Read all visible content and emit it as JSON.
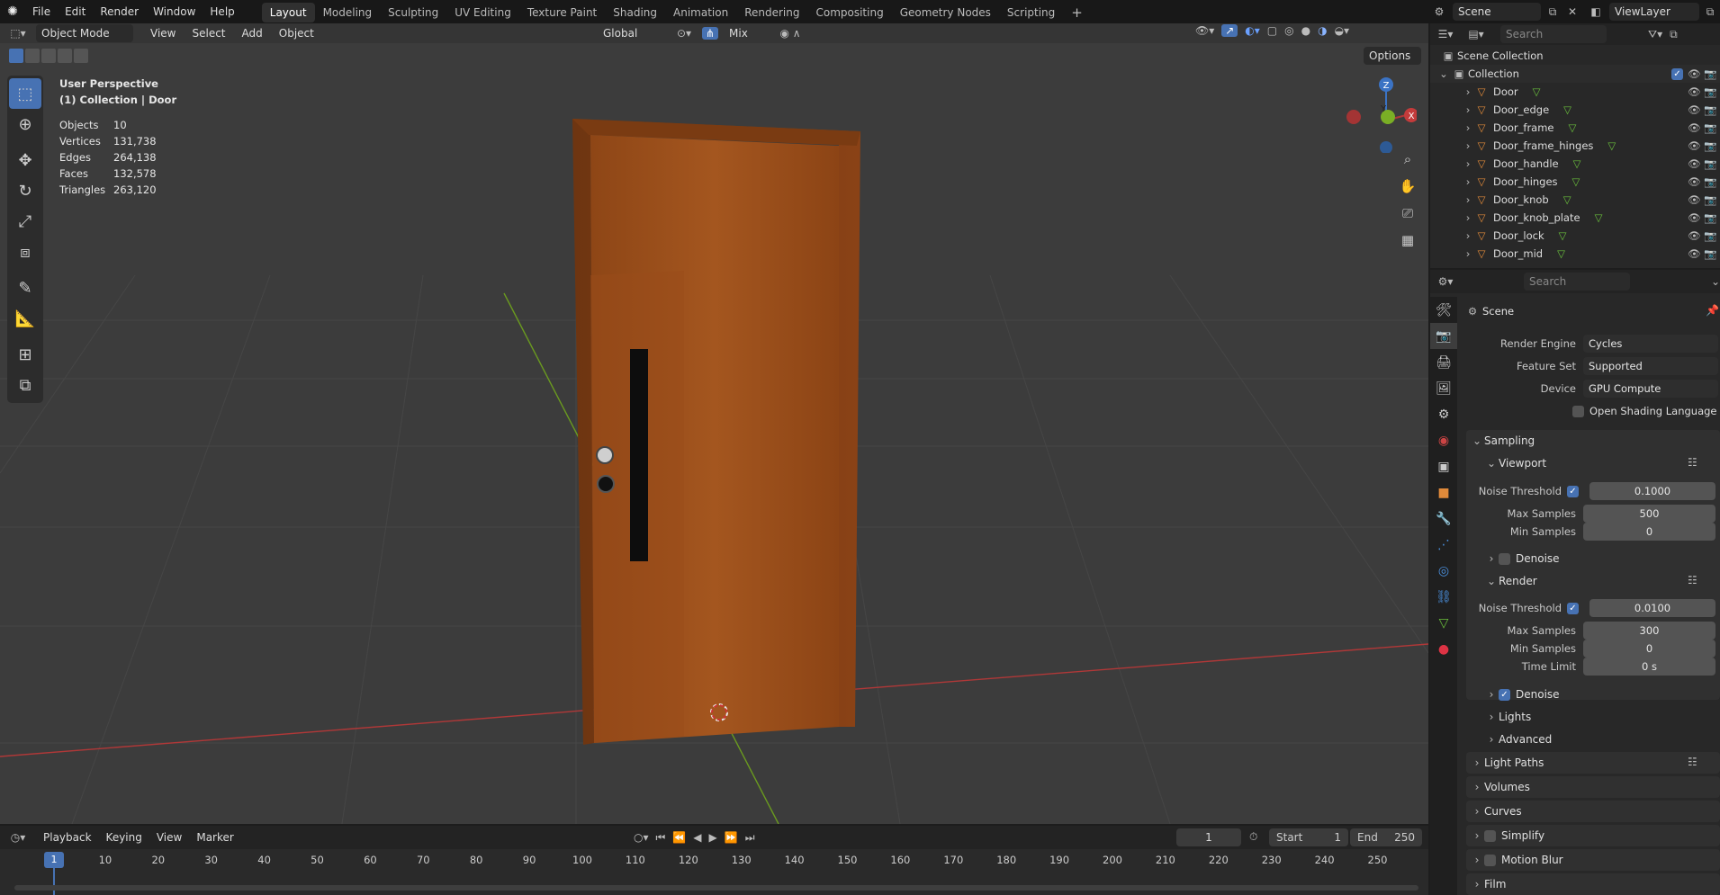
{
  "topbar": {
    "menus": [
      "File",
      "Edit",
      "Render",
      "Window",
      "Help"
    ],
    "workspaces": [
      "Layout",
      "Modeling",
      "Sculpting",
      "UV Editing",
      "Texture Paint",
      "Shading",
      "Animation",
      "Rendering",
      "Compositing",
      "Geometry Nodes",
      "Scripting"
    ],
    "active_workspace": "Layout",
    "add_workspace": "+",
    "scene": "Scene",
    "view_layer": "ViewLayer"
  },
  "viewport": {
    "mode": "Object Mode",
    "menus": [
      "View",
      "Select",
      "Add",
      "Object"
    ],
    "transform_orientation": "Global",
    "snap_mode": "Mix",
    "options_label": "Options",
    "perspective": "User Perspective",
    "collection_path": "(1) Collection | Door",
    "stats": [
      {
        "label": "Objects",
        "value": "10"
      },
      {
        "label": "Vertices",
        "value": "131,738"
      },
      {
        "label": "Edges",
        "value": "264,138"
      },
      {
        "label": "Faces",
        "value": "132,578"
      },
      {
        "label": "Triangles",
        "value": "263,120"
      }
    ],
    "gizmo_labels": {
      "z": "Z",
      "y": "Y",
      "x": "X"
    }
  },
  "outliner": {
    "search_placeholder": "Search",
    "scene_collection": "Scene Collection",
    "collection": "Collection",
    "objects": [
      "Door",
      "Door_edge",
      "Door_frame",
      "Door_frame_hinges",
      "Door_handle",
      "Door_hinges",
      "Door_knob",
      "Door_knob_plate",
      "Door_lock",
      "Door_mid"
    ]
  },
  "properties": {
    "search_placeholder": "Search",
    "context_title": "Scene",
    "render_engine_label": "Render Engine",
    "render_engine": "Cycles",
    "feature_set_label": "Feature Set",
    "feature_set": "Supported",
    "device_label": "Device",
    "device": "GPU Compute",
    "osl_label": "Open Shading Language",
    "sampling_label": "Sampling",
    "viewport_label": "Viewport",
    "noise_threshold_label": "Noise Threshold",
    "viewport_noise_threshold": "0.1000",
    "max_samples_label": "Max Samples",
    "viewport_max_samples": "500",
    "min_samples_label": "Min Samples",
    "viewport_min_samples": "0",
    "denoise_label": "Denoise",
    "render_label": "Render",
    "render_noise_threshold": "0.0100",
    "render_max_samples": "300",
    "render_min_samples": "0",
    "time_limit_label": "Time Limit",
    "time_limit": "0 s",
    "lights_label": "Lights",
    "advanced_label": "Advanced",
    "light_paths_label": "Light Paths",
    "volumes_label": "Volumes",
    "curves_label": "Curves",
    "simplify_label": "Simplify",
    "motion_blur_label": "Motion Blur",
    "film_label": "Film"
  },
  "timeline": {
    "menus": [
      "Playback",
      "Keying",
      "View",
      "Marker"
    ],
    "current_frame": "1",
    "start_label": "Start",
    "start": "1",
    "end_label": "End",
    "end": "250",
    "ticks": [
      "10",
      "20",
      "30",
      "40",
      "50",
      "60",
      "70",
      "80",
      "90",
      "100",
      "110",
      "120",
      "130",
      "140",
      "150",
      "160",
      "170",
      "180",
      "190",
      "200",
      "210",
      "220",
      "230",
      "240",
      "250"
    ]
  },
  "colors": {
    "accent": "#4772b3",
    "wood": "#a0521e",
    "x_axis": "#b03838",
    "y_axis": "#6a9a1f"
  }
}
